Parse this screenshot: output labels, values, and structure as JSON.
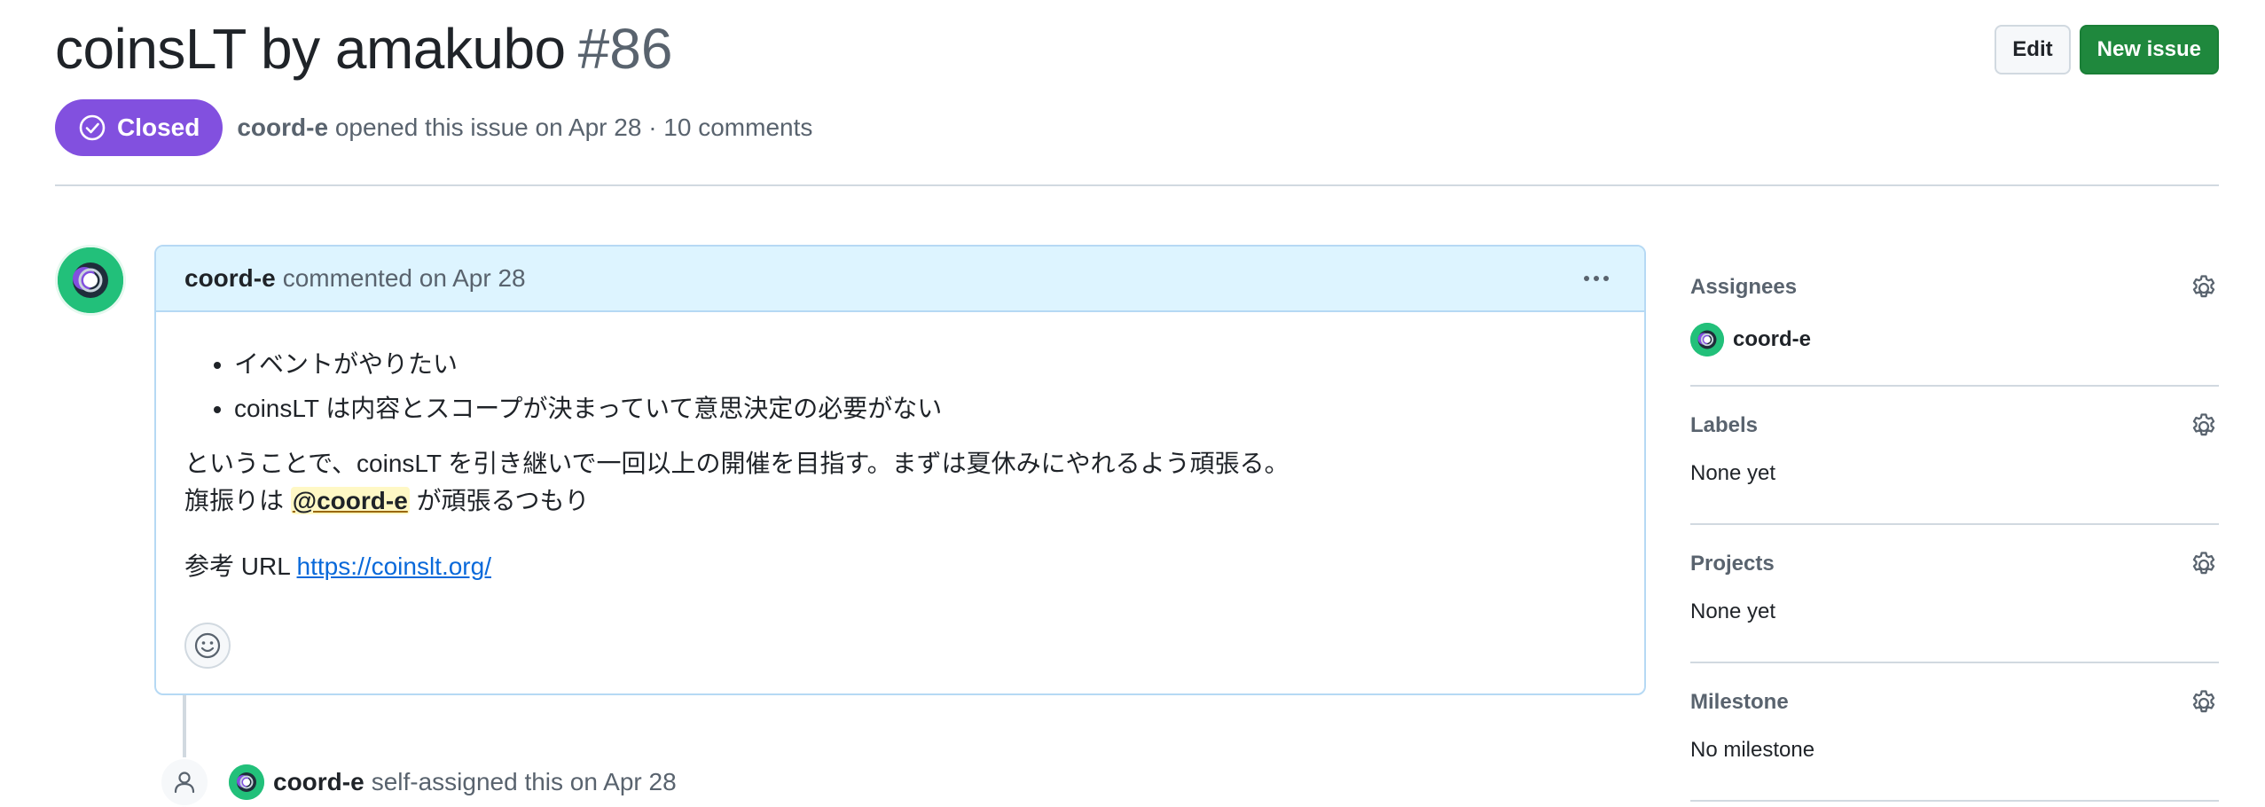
{
  "issue": {
    "title": "coinsLT by amakubo",
    "number": "#86",
    "state": "Closed",
    "opened_by": "coord-e",
    "opened_text": "opened this issue on Apr 28 · 10 comments"
  },
  "header_actions": {
    "edit_label": "Edit",
    "new_issue_label": "New issue"
  },
  "comment": {
    "author": "coord-e",
    "meta": "commented on Apr 28",
    "bullets": [
      "イベントがやりたい",
      "coinsLT は内容とスコープが決まっていて意思決定の必要がない"
    ],
    "line1": "ということで、coinsLT を引き継いで一回以上の開催を目指す。まずは夏休みにやれるよう頑張る。",
    "line2_prefix": "旗振りは",
    "mention": "@coord-e",
    "line2_suffix": "が頑張るつもり",
    "ref_prefix": "参考 URL",
    "ref_link": "https://coinslt.org/"
  },
  "timeline_event": {
    "author": "coord-e",
    "text": "self-assigned this on Apr 28"
  },
  "sidebar": {
    "assignees": {
      "heading": "Assignees",
      "value": "coord-e"
    },
    "labels": {
      "heading": "Labels",
      "value": "None yet"
    },
    "projects": {
      "heading": "Projects",
      "value": "None yet"
    },
    "milestone": {
      "heading": "Milestone",
      "value": "No milestone"
    }
  },
  "colors": {
    "closed_badge": "#8250df",
    "new_issue_button": "#1f883d",
    "comment_header": "#ddf4ff",
    "link": "#0969da",
    "avatar": "#22c07a"
  },
  "icons": {
    "state": "issue-closed-icon",
    "comment_menu": "kebab-horizontal-icon",
    "reaction": "smiley-icon",
    "timeline": "person-icon",
    "sidebar_settings": "gear-icon"
  }
}
